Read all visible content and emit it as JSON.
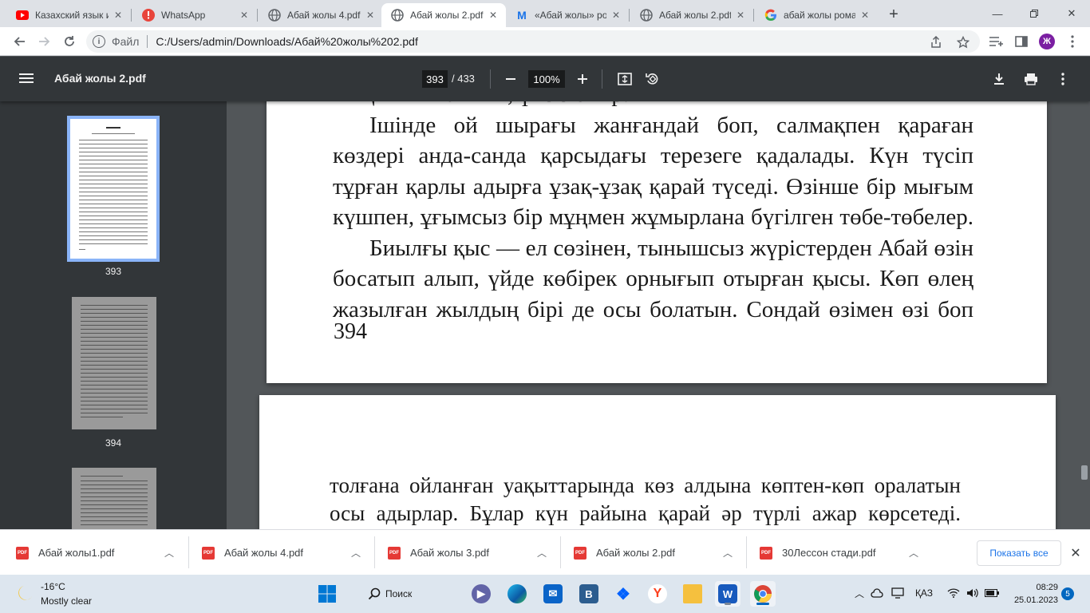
{
  "tabs": [
    {
      "title": "Казахский язык и",
      "icon": "youtube-icon",
      "active": false
    },
    {
      "title": "WhatsApp",
      "icon": "whatsapp-icon",
      "active": false
    },
    {
      "title": "Абай жолы 4.pdf",
      "icon": "globe-icon",
      "active": false
    },
    {
      "title": "Абай жолы 2.pdf",
      "icon": "globe-icon",
      "active": true
    },
    {
      "title": "«Абай жолы» ро",
      "icon": "m-icon",
      "active": false
    },
    {
      "title": "Абай жолы 2.pdf",
      "icon": "globe-icon",
      "active": false
    },
    {
      "title": "абай жолы рома",
      "icon": "google-icon",
      "active": false
    }
  ],
  "address": {
    "scheme": "Файл",
    "url": "C:/Users/admin/Downloads/Абай%20жолы%202.pdf"
  },
  "profile_initial": "Ж",
  "pdf": {
    "title": "Абай жолы 2.pdf",
    "current_page": "393",
    "total_pages": "/ 433",
    "zoom": "100%"
  },
  "thumbnails": [
    {
      "label": "393",
      "selected": true
    },
    {
      "label": "394",
      "selected": false
    },
    {
      "label": "",
      "selected": false
    }
  ],
  "page1": {
    "lines": [
      "мықынып таянып, үнсіз отыр.",
      "Ішінде ой шырағы жанғандай боп, салмақпен қараған",
      "көздері анда-санда қарсыдағы терезеге қадалады. Күн түсіп",
      "тұрған қарлы адырға ұзақ-ұзақ қарай түседі. Өзінше бір мығым",
      "күшпен, ұғымсыз бір мұңмен жұмырлана бүгілген төбе-төбелер.",
      "Биылғы қыс — ел сөзінен, тынышсыз жүрістерден Абай өзін",
      "босатып алып, үйде көбірек орнығып отырған қысы. Көп өлең",
      "жазылған жылдың бірі де осы болатын. Сондай өзімен өзі боп"
    ],
    "page_number": "394"
  },
  "page2": {
    "lines": [
      "толғана ойланған уақыттарында көз алдына көптен-көп оралатын",
      "осы адырлар. Бұлар күн райына қарай әр түрлі ажар көрсетеді."
    ]
  },
  "downloads": [
    {
      "name": "Абай жолы1.pdf"
    },
    {
      "name": "Абай жолы 4.pdf"
    },
    {
      "name": "Абай жолы 3.pdf"
    },
    {
      "name": "Абай жолы 2.pdf"
    },
    {
      "name": "30Лессон стади.pdf"
    }
  ],
  "show_all": "Показать все",
  "taskbar": {
    "weather_temp": "-16°C",
    "weather_desc": "Mostly clear",
    "search_label": "Поиск",
    "language": "ҚАЗ",
    "time": "08:29",
    "date": "25.01.2023",
    "notifications": "5"
  }
}
